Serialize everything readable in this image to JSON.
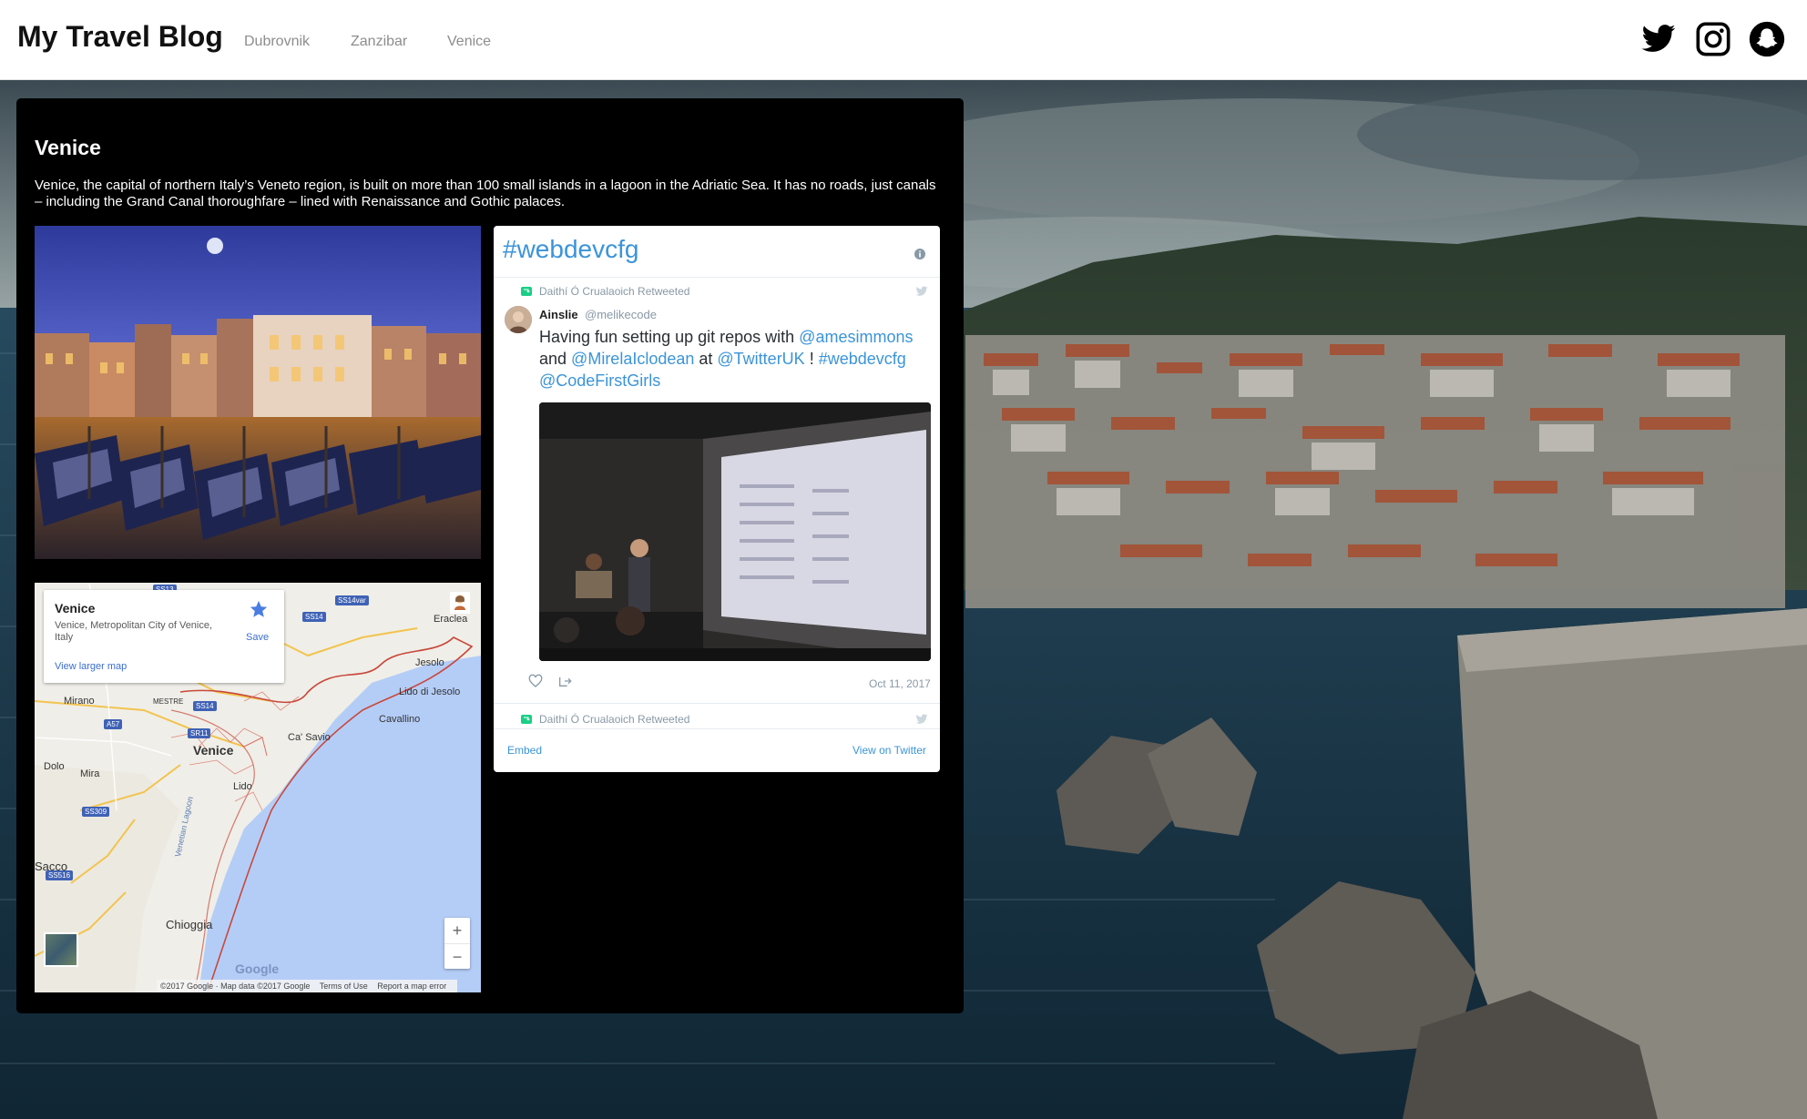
{
  "header": {
    "brand": "My Travel Blog",
    "nav": [
      "Dubrovnik",
      "Zanzibar",
      "Venice"
    ],
    "social": [
      "twitter-icon",
      "instagram-icon",
      "snapchat-icon"
    ]
  },
  "article": {
    "title": "Venice",
    "description": "Venice, the capital of northern Italy’s Veneto region, is built on more than 100 small islands in a lagoon in the Adriatic Sea. It has no roads, just canals – including the Grand Canal thoroughfare – lined with Renaissance and Gothic palaces."
  },
  "map": {
    "place": "Venice",
    "address": "Venice, Metropolitan City of Venice, Italy",
    "larger_map": "View larger map",
    "save": "Save",
    "labels": {
      "eraclea": "Eraclea",
      "jesolo": "Jesolo",
      "lido_di_jesolo": "Lido di Jesolo",
      "mirano": "Mirano",
      "mestre": "MESTRE",
      "cavallino": "Cavallino",
      "ca_savio": "Ca' Savio",
      "venice": "Venice",
      "dolo": "Dolo",
      "mira": "Mira",
      "lido": "Lido",
      "sacco": "Sacco",
      "chioggia": "Chioggia",
      "lagoon": "Venetian Lagoon"
    },
    "roads": [
      "SS13",
      "SS14var",
      "SS14",
      "SS14",
      "A57",
      "SR11",
      "SS309",
      "SS516"
    ],
    "zoom_in": "+",
    "zoom_out": "−",
    "logo": "Google",
    "footer": [
      "©2017 Google · Map data ©2017 Google",
      "Terms of Use",
      "Report a map error"
    ]
  },
  "twitter": {
    "title": "#webdevcfg",
    "retweeted_by": "Daithí Ó Crualaoich Retweeted",
    "author": "Ainslie",
    "handle": "@melikecode",
    "text": {
      "t1": "Having fun setting up git repos with ",
      "m1": "@amesimmons",
      "t2": "and ",
      "m2": "@MirelaIclodean",
      "t3": " at ",
      "m3": "@TwitterUK",
      "t4": " ! ",
      "m4": "#webdevcfg",
      "m5": "@CodeFirstGirls"
    },
    "date": "Oct 11, 2017",
    "embed": "Embed",
    "view": "View on Twitter"
  },
  "colors": {
    "accent": "#3b94d9",
    "card_bg": "#000000",
    "nav": "#8d8d8d"
  }
}
